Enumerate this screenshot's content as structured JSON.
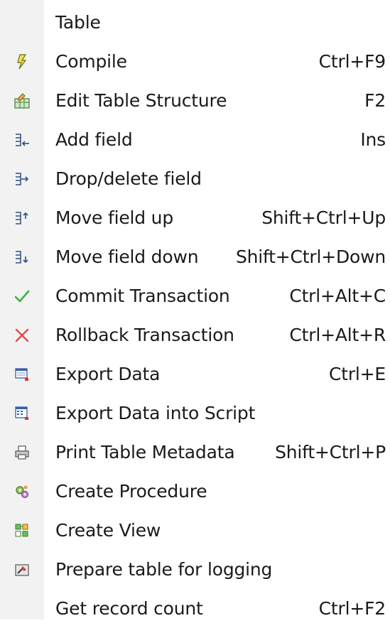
{
  "menu": {
    "items": [
      {
        "label": "Table",
        "shortcut": "",
        "icon": "none"
      },
      {
        "label": "Compile",
        "shortcut": "Ctrl+F9",
        "icon": "lightning-icon"
      },
      {
        "label": "Edit Table Structure",
        "shortcut": "F2",
        "icon": "edit-table-icon"
      },
      {
        "label": "Add field",
        "shortcut": "Ins",
        "icon": "add-field-icon"
      },
      {
        "label": "Drop/delete field",
        "shortcut": "",
        "icon": "drop-field-icon"
      },
      {
        "label": "Move field up",
        "shortcut": "Shift+Ctrl+Up",
        "icon": "move-up-icon"
      },
      {
        "label": "Move field down",
        "shortcut": "Shift+Ctrl+Down",
        "icon": "move-down-icon"
      },
      {
        "label": "Commit Transaction",
        "shortcut": "Ctrl+Alt+C",
        "icon": "checkmark-icon"
      },
      {
        "label": "Rollback Transaction",
        "shortcut": "Ctrl+Alt+R",
        "icon": "x-icon"
      },
      {
        "label": "Export Data",
        "shortcut": "Ctrl+E",
        "icon": "export-data-icon"
      },
      {
        "label": "Export Data into Script",
        "shortcut": "",
        "icon": "export-script-icon"
      },
      {
        "label": "Print Table Metadata",
        "shortcut": "Shift+Ctrl+P",
        "icon": "printer-icon"
      },
      {
        "label": "Create Procedure",
        "shortcut": "",
        "icon": "gears-icon"
      },
      {
        "label": "Create View",
        "shortcut": "",
        "icon": "view-icon"
      },
      {
        "label": "Prepare table for logging",
        "shortcut": "",
        "icon": "logging-icon"
      },
      {
        "label": "Get record count",
        "shortcut": "Ctrl+F2",
        "icon": "none"
      }
    ]
  }
}
